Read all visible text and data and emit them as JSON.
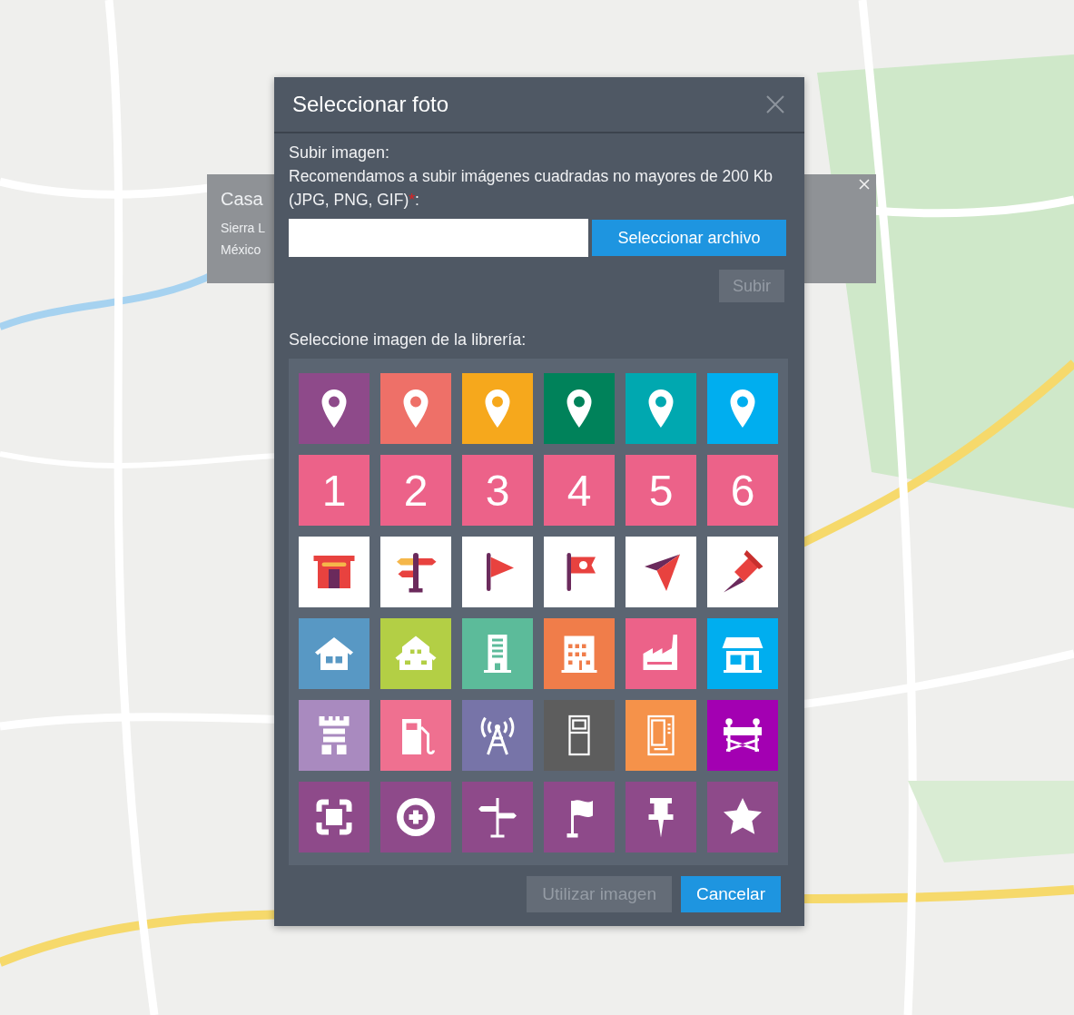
{
  "map_popup": {
    "title": "Casa",
    "lines": [
      "Sierra L",
      "México"
    ]
  },
  "dialog": {
    "title": "Seleccionar foto",
    "upload_label": "Subir imagen:",
    "hint": "Recomendamos a subir imágenes cuadradas no mayores de 200 Kb (JPG, PNG, GIF)",
    "required_mark": "*",
    "hint_end": ":",
    "file_button": {
      "label": "Seleccionar archivo",
      "disabled": false
    },
    "upload_button": {
      "label": "Subir",
      "disabled": true
    },
    "library_label": "Seleccione imagen de la librería:",
    "library": [
      {
        "kind": "pin",
        "color": "#8e4a8a"
      },
      {
        "kind": "pin",
        "color": "#ee7068"
      },
      {
        "kind": "pin",
        "color": "#f6a81c"
      },
      {
        "kind": "pin",
        "color": "#00825a"
      },
      {
        "kind": "pin",
        "color": "#00a8b0"
      },
      {
        "kind": "pin",
        "color": "#00aeef"
      },
      {
        "kind": "number",
        "label": "1",
        "color": "#ec6289"
      },
      {
        "kind": "number",
        "label": "2",
        "color": "#ec6289"
      },
      {
        "kind": "number",
        "label": "3",
        "color": "#ec6289"
      },
      {
        "kind": "number",
        "label": "4",
        "color": "#ec6289"
      },
      {
        "kind": "number",
        "label": "5",
        "color": "#ec6289"
      },
      {
        "kind": "number",
        "label": "6",
        "color": "#ec6289"
      },
      {
        "kind": "store",
        "color": "#ffffff"
      },
      {
        "kind": "signpost",
        "color": "#ffffff"
      },
      {
        "kind": "flag",
        "color": "#ffffff"
      },
      {
        "kind": "banner",
        "color": "#ffffff"
      },
      {
        "kind": "arrow",
        "color": "#ffffff"
      },
      {
        "kind": "pushpin",
        "color": "#ffffff"
      },
      {
        "kind": "house",
        "color": "#5898c4"
      },
      {
        "kind": "homes",
        "color": "#b3cf45"
      },
      {
        "kind": "tower",
        "color": "#5cbb9a"
      },
      {
        "kind": "bank",
        "color": "#f07d4a"
      },
      {
        "kind": "factory",
        "color": "#ec6289"
      },
      {
        "kind": "shop",
        "color": "#00aeef"
      },
      {
        "kind": "castle",
        "color": "#a98abf"
      },
      {
        "kind": "fuel",
        "color": "#ef7090"
      },
      {
        "kind": "antenna",
        "color": "#7774a8"
      },
      {
        "kind": "atm",
        "color": "#5d5d5d"
      },
      {
        "kind": "vending",
        "color": "#f5924a"
      },
      {
        "kind": "barrier",
        "color": "#a300b2"
      },
      {
        "kind": "frame",
        "color": "#8e4a8a"
      },
      {
        "kind": "target",
        "color": "#8e4a8a"
      },
      {
        "kind": "signs",
        "color": "#8e4a8a"
      },
      {
        "kind": "flagpole",
        "color": "#8e4a8a"
      },
      {
        "kind": "thumbtack",
        "color": "#8e4a8a"
      },
      {
        "kind": "star",
        "color": "#8e4a8a"
      }
    ],
    "buttons": [
      {
        "label": "Utilizar imagen",
        "disabled": true
      },
      {
        "label": "Cancelar",
        "disabled": false
      }
    ]
  }
}
